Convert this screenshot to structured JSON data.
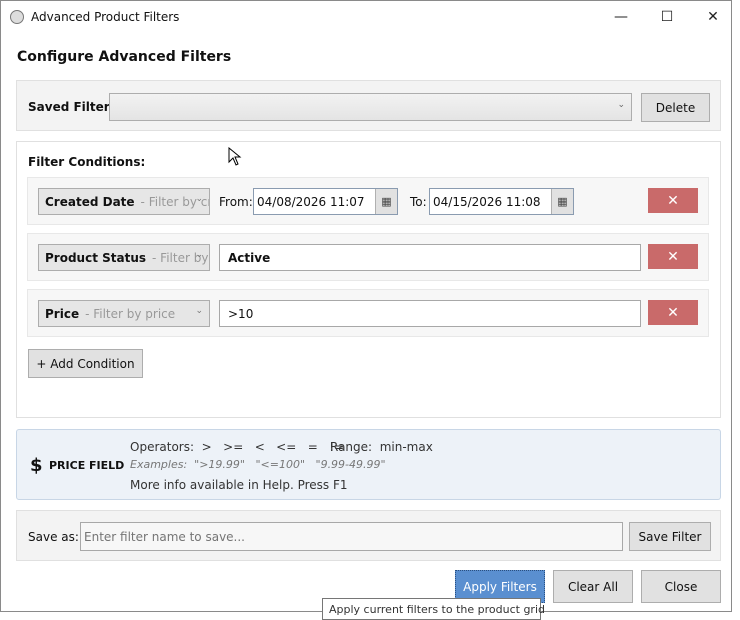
{
  "window": {
    "title": "Advanced Product Filters",
    "minimize": "—",
    "maximize": "☐",
    "close": "✕"
  },
  "heading": "Configure Advanced Filters",
  "saved_filters": {
    "label": "Saved Filters:",
    "value": "",
    "delete_label": "Delete"
  },
  "conditions": {
    "label": "Filter Conditions:",
    "rows": [
      {
        "field": "Created Date",
        "hint": "Filter by cr",
        "from_label": "From:",
        "from": "04/08/2026 11:07",
        "to_label": "To:",
        "to": "04/15/2026 11:08",
        "remove": "✕"
      },
      {
        "field": "Product Status",
        "hint": "Filter by",
        "value": "Active",
        "remove": "✕"
      },
      {
        "field": "Price",
        "hint": "Filter by price",
        "value": ">10",
        "remove": "✕"
      }
    ],
    "add_label": "+ Add Condition"
  },
  "info": {
    "icon": "$",
    "title": "PRICE FIELD",
    "operators": "Operators:  >   >=   <   <=   =   !=",
    "range": "Range:  min-max",
    "examples": "Examples:  \">19.99\"   \"<=100\"   \"9.99-49.99\"",
    "more": "More info available in Help. Press F1"
  },
  "save": {
    "label": "Save as:",
    "placeholder": "Enter filter name to save...",
    "button": "Save Filter"
  },
  "footer": {
    "apply": "Apply Filters",
    "clear": "Clear All",
    "close": "Close"
  },
  "tooltip": "Apply current filters to the product grid",
  "colors": {
    "accent": "#5a8fd0",
    "remove": "#c96a6a",
    "info_bg": "#edf2f8"
  }
}
